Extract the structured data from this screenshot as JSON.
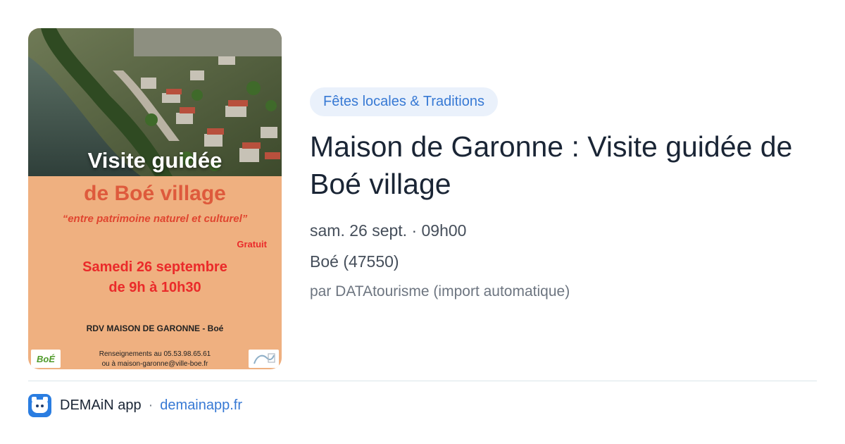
{
  "poster": {
    "title": "Visite guidée",
    "subtitle": "de Boé village",
    "tagline": "“entre patrimoine naturel et culturel”",
    "free_label": "Gratuit",
    "date_line1": "Samedi 26 septembre",
    "date_line2": "de 9h à 10h30",
    "rdv": "RDV MAISON DE GARONNE - Boé",
    "info_line1": "Renseignements au 05.53.98.65.61",
    "info_line2": "ou à maison-garonne@ville-boe.fr",
    "logo_left_text": "BoÉ",
    "colors": {
      "background": "#efb080",
      "title": "#ffffff",
      "subtitle": "#de5a3c",
      "date": "#ea2a2a"
    }
  },
  "event": {
    "category": "Fêtes locales & Traditions",
    "title": "Maison de Garonne : Visite guidée de Boé village",
    "date": "sam. 26 sept. · 09h00",
    "place": "Boé (47550)",
    "source": "par DATAtourisme (import automatique)"
  },
  "footer": {
    "app_icon": "demain-app-icon",
    "app_name": "DEMAiN app",
    "separator": "·",
    "link_text": "demainapp.fr"
  },
  "colors": {
    "accent": "#3779d4",
    "tag_background": "#eaf1fb",
    "title_text": "#1a2535",
    "meta_text": "#454e5a"
  }
}
